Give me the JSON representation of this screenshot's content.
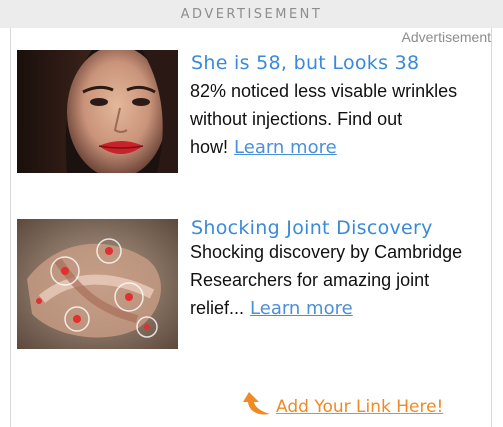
{
  "header": {
    "title": "ADVERTISEMENT"
  },
  "ad_label": "Advertisement",
  "items": [
    {
      "title": "She is 58, but Looks 38",
      "body": "82% noticed less visable wrinkles without injections. Find out how!",
      "link": "Learn more",
      "image": "woman-face-photo"
    },
    {
      "title": "Shocking Joint Discovery",
      "body": "Shocking discovery by Cambridge Researchers for amazing joint relief...",
      "link": "Learn more",
      "image": "joint-anatomy-photo"
    }
  ],
  "footer": {
    "add_link": "Add Your Link Here!",
    "arrow_icon": "curved-arrow-icon",
    "accent": "#f08a24"
  },
  "colors": {
    "title": "#3a8ad9",
    "link": "#4a90d9",
    "header_bg": "#ececec"
  }
}
